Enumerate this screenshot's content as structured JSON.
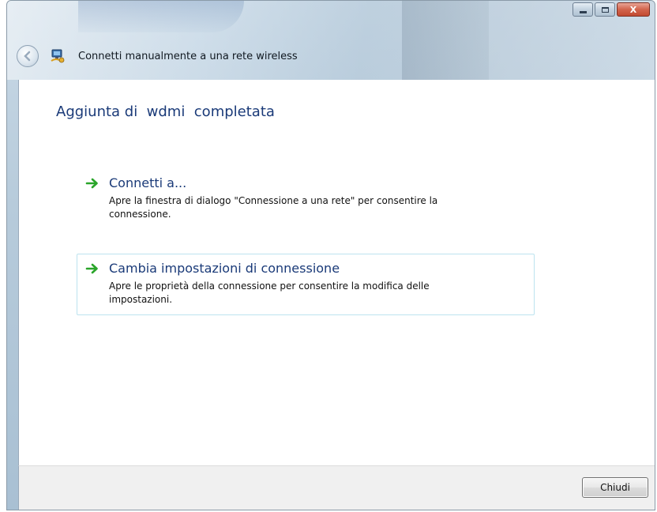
{
  "window": {
    "title": "Connetti manualmente a una rete wireless",
    "caption_buttons": [
      "minimize",
      "maximize",
      "close"
    ],
    "close_glyph": "X"
  },
  "nav": {
    "back_icon": "back-arrow-icon",
    "app_icon": "network-icon"
  },
  "main": {
    "heading": "Aggiunta di  wdmi  completata",
    "options": [
      {
        "label": "Connetti a...",
        "description": "Apre la finestra di dialogo \"Connessione a una rete\" per consentire la connessione.",
        "icon": "green-arrow-icon"
      },
      {
        "label": "Cambia impostazioni di connessione",
        "description": "Apre le proprietà della connessione per consentire la modifica delle impostazioni.",
        "icon": "green-arrow-icon",
        "highlighted": true
      }
    ]
  },
  "footer": {
    "close_label": "Chiudi"
  },
  "colors": {
    "heading": "#1a3a78",
    "arrow": "#2aa52a",
    "hover_border": "#bde3ef",
    "close_button": "#c24a31"
  }
}
